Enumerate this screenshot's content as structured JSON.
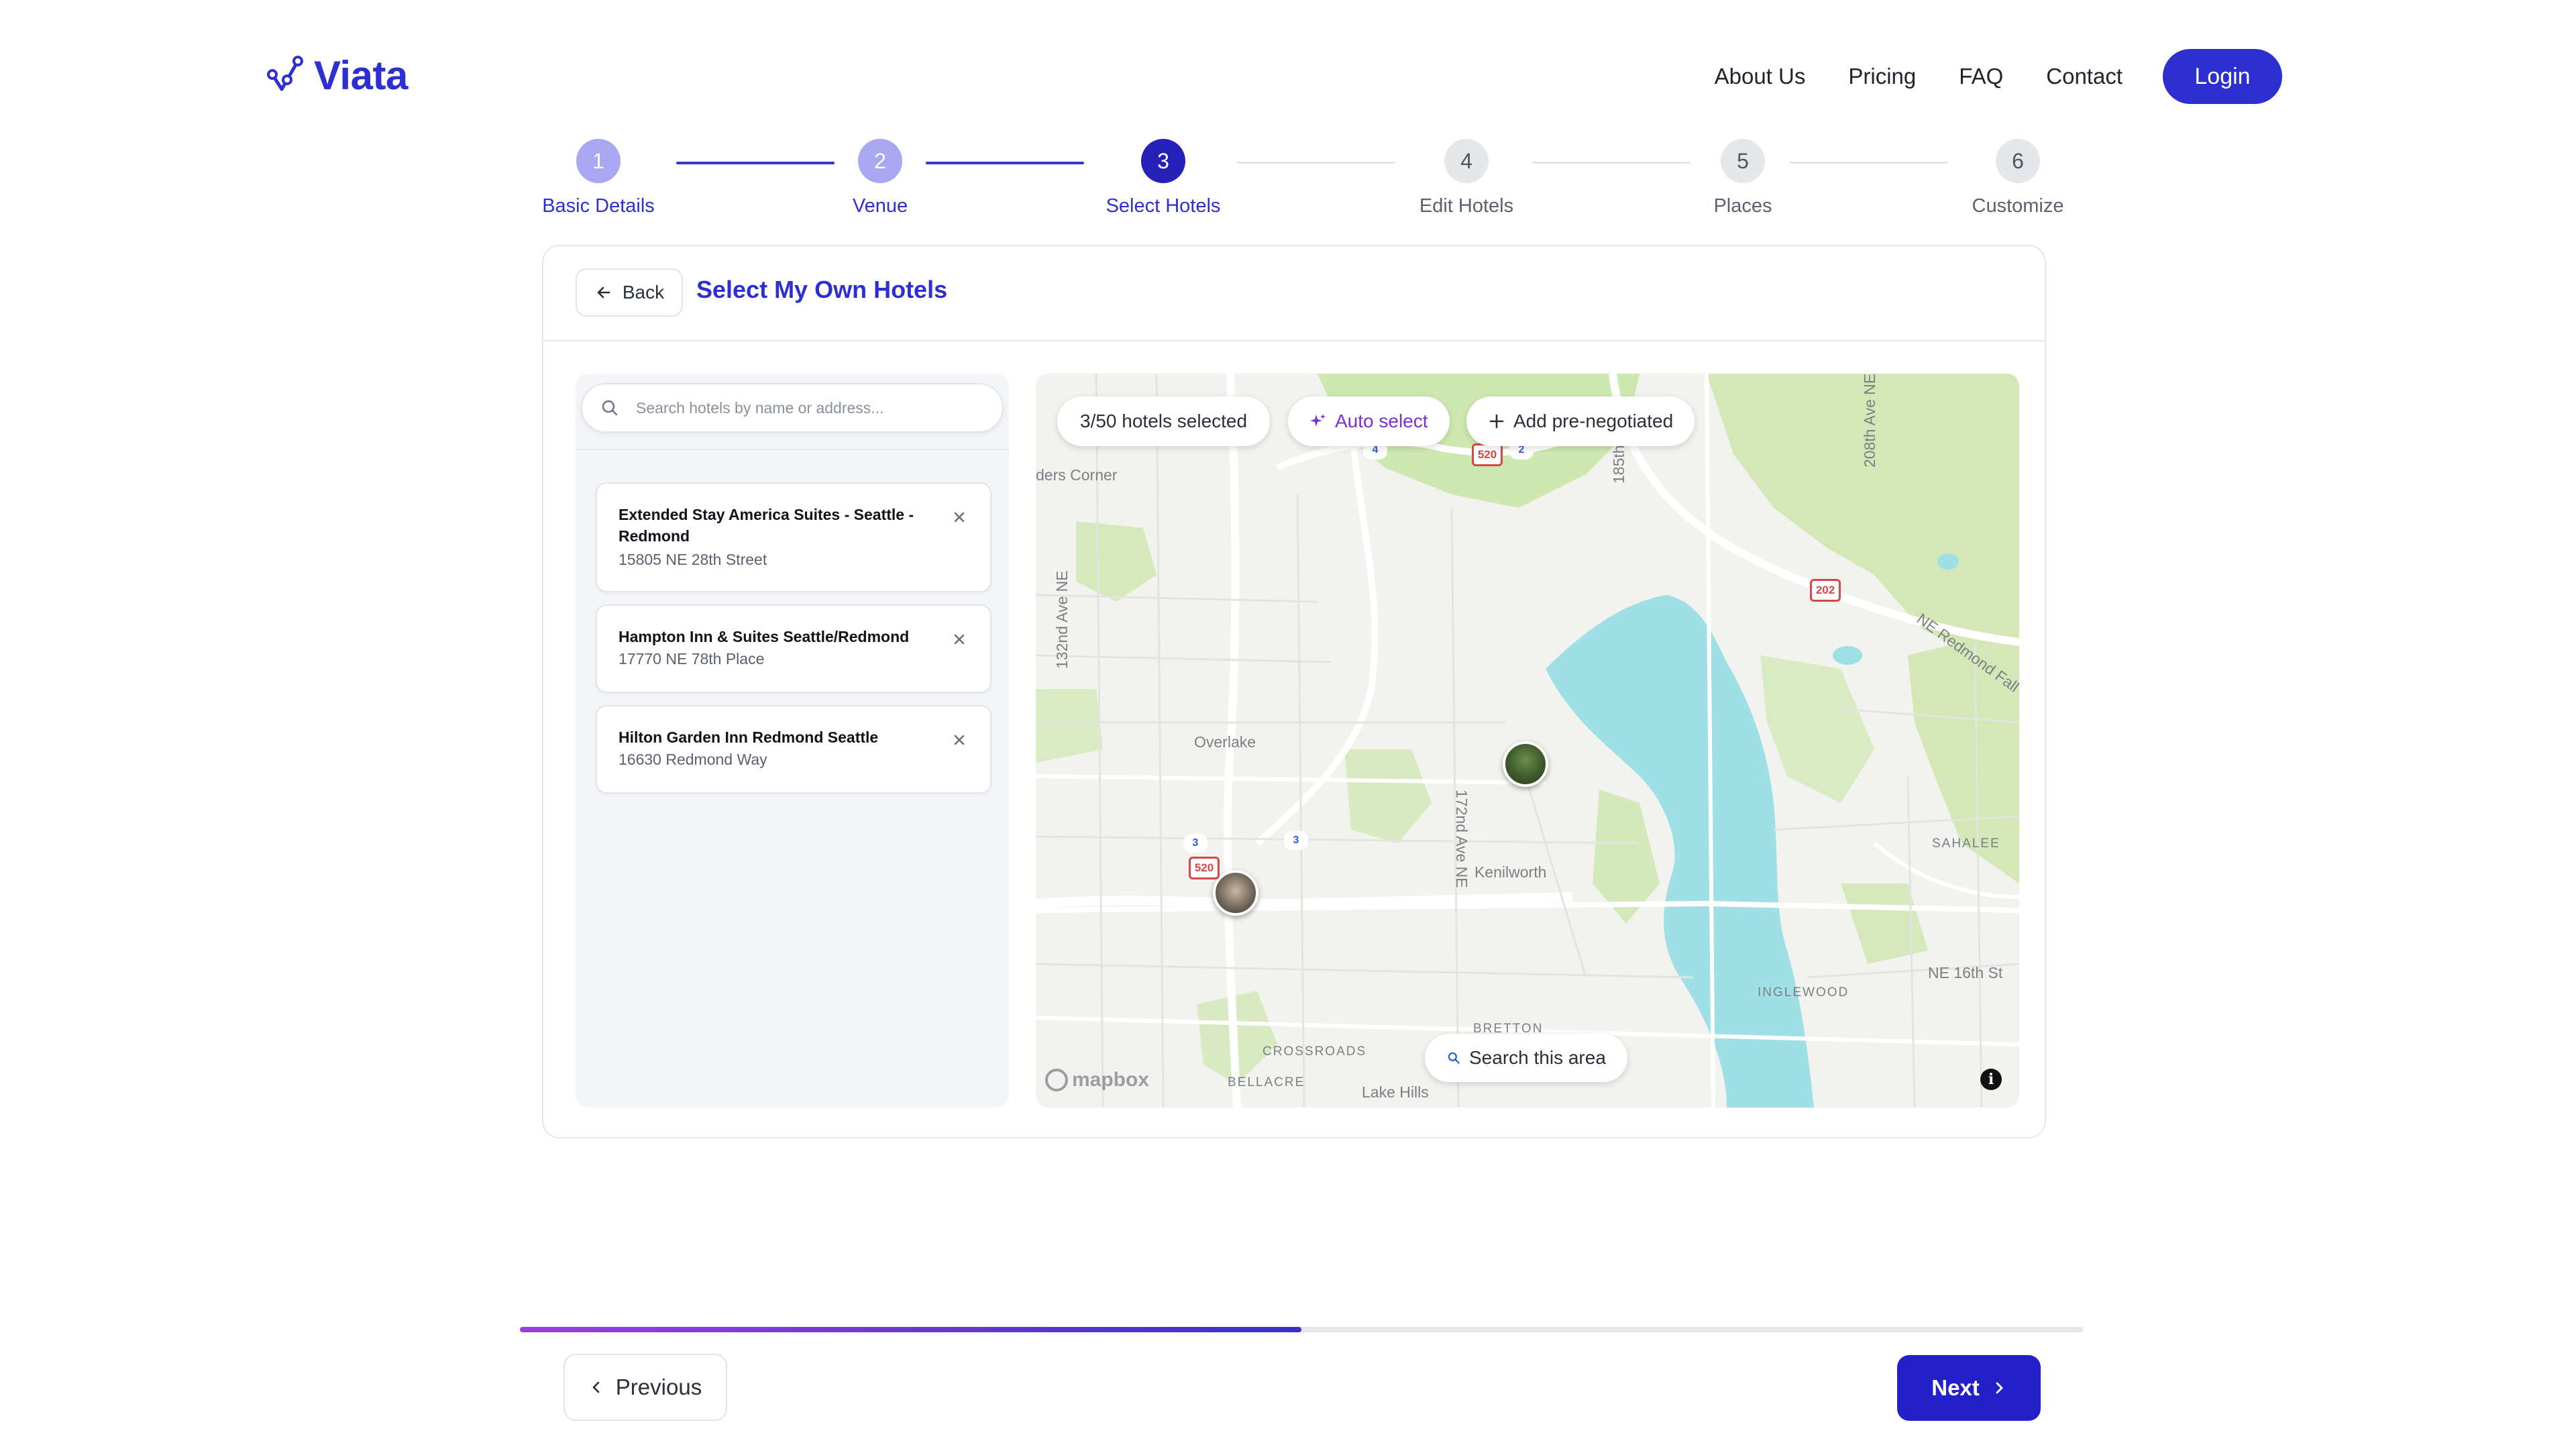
{
  "brand": {
    "name": "Viata",
    "color": "#2e2fd0"
  },
  "nav": {
    "links": [
      "About Us",
      "Pricing",
      "FAQ",
      "Contact"
    ],
    "login_label": "Login"
  },
  "stepper": {
    "steps": [
      {
        "number": "1",
        "label": "Basic Details",
        "state": "done"
      },
      {
        "number": "2",
        "label": "Venue",
        "state": "done"
      },
      {
        "number": "3",
        "label": "Select Hotels",
        "state": "active"
      },
      {
        "number": "4",
        "label": "Edit Hotels",
        "state": "todo"
      },
      {
        "number": "5",
        "label": "Places",
        "state": "todo"
      },
      {
        "number": "6",
        "label": "Customize",
        "state": "todo"
      }
    ]
  },
  "card": {
    "back_label": "Back",
    "title": "Select My Own Hotels"
  },
  "search": {
    "placeholder": "Search hotels by name or address...",
    "value": ""
  },
  "hotels": [
    {
      "name": "Extended Stay America Suites - Seattle - Redmond",
      "address": "15805 NE 28th Street"
    },
    {
      "name": "Hampton Inn & Suites Seattle/Redmond",
      "address": "17770 NE 78th Place"
    },
    {
      "name": "Hilton Garden Inn Redmond Seattle",
      "address": "16630 Redmond Way"
    }
  ],
  "map": {
    "selected_count": "3/50 hotels selected",
    "auto_select_label": "Auto select",
    "add_prenegotiated_label": "Add pre-negotiated",
    "search_area_label": "Search this area",
    "attribution": "mapbox",
    "info_label": "i",
    "labels": {
      "ders_corner": "ders Corner",
      "overlake": "Overlake",
      "kenilworth": "Kenilworth",
      "crossroads": "CROSSROADS",
      "bellacre": "BELLACRE",
      "lake_hills": "Lake Hills",
      "bretton": "BRETTON",
      "inglewood": "INGLEWOOD",
      "sahalee": "SAHALEE",
      "ne_16th": "NE 16th St",
      "ne_redmond_fall": "NE Redmond Fall C",
      "ave_132": "132nd Ave NE",
      "ave_172": "172nd Ave NE",
      "ave_185": "185th",
      "ave_208": "208th Ave NE"
    },
    "shields": [
      "520",
      "202",
      "520"
    ],
    "route_badges": [
      "4",
      "2",
      "3",
      "3"
    ],
    "colors": {
      "water": "#9fdfe6",
      "park": "#cfe7b0",
      "road": "#ffffff"
    }
  },
  "progress": {
    "fraction": 0.5
  },
  "footer": {
    "previous_label": "Previous",
    "next_label": "Next"
  }
}
